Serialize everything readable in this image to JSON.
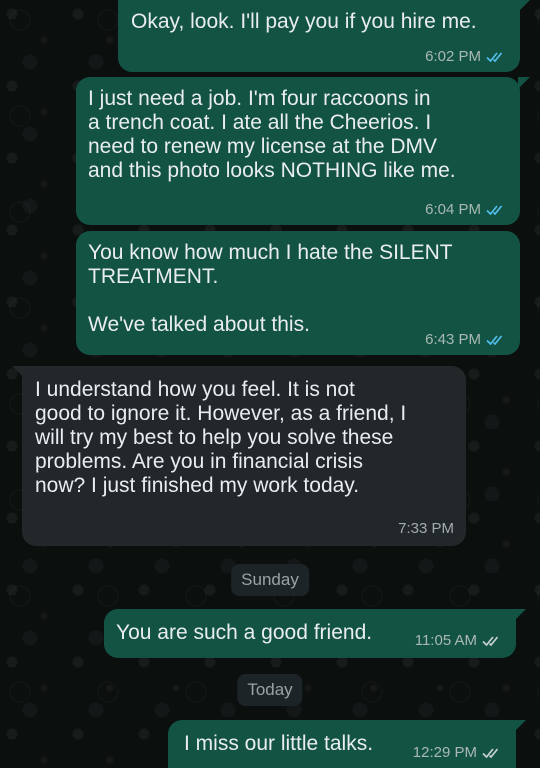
{
  "chat": {
    "messages": [
      {
        "direction": "outgoing",
        "text": "Okay, look.  I'll pay you if you hire me.",
        "time": "6:02 PM",
        "status_icon": "double-check-read-icon"
      },
      {
        "direction": "outgoing",
        "text": "I just need a job.  I'm four raccoons in\na trench coat.  I ate all the Cheerios.  I\nneed to renew my license at the DMV\nand this photo looks NOTHING like me.",
        "time": "6:04 PM",
        "status_icon": "double-check-read-icon"
      },
      {
        "direction": "outgoing",
        "text": "You know how much I hate the SILENT\nTREATMENT.\n\nWe've talked about this.",
        "time": "6:43 PM",
        "status_icon": "double-check-read-icon"
      },
      {
        "direction": "incoming",
        "text": "I understand how you feel. It is not\ngood to ignore it. However, as a friend, I\nwill try my best to help you solve these\nproblems. Are you in financial crisis\nnow? I just finished my work today.",
        "time": "7:33 PM"
      },
      {
        "direction": "outgoing",
        "text": "You are such a good friend.",
        "time": "11:05 AM",
        "status_icon": "double-check-sent-icon"
      },
      {
        "direction": "outgoing",
        "text": "I miss our little talks.",
        "time": "12:29 PM",
        "status_icon": "double-check-sent-icon"
      }
    ],
    "day_separators": {
      "sunday": "Sunday",
      "today": "Today"
    }
  },
  "colors": {
    "outgoing_bubble": "#135343",
    "incoming_bubble": "#22272a",
    "read_tick": "#53bdeb",
    "sent_tick": "#c9d1cf",
    "background": "#0b0f0e"
  }
}
